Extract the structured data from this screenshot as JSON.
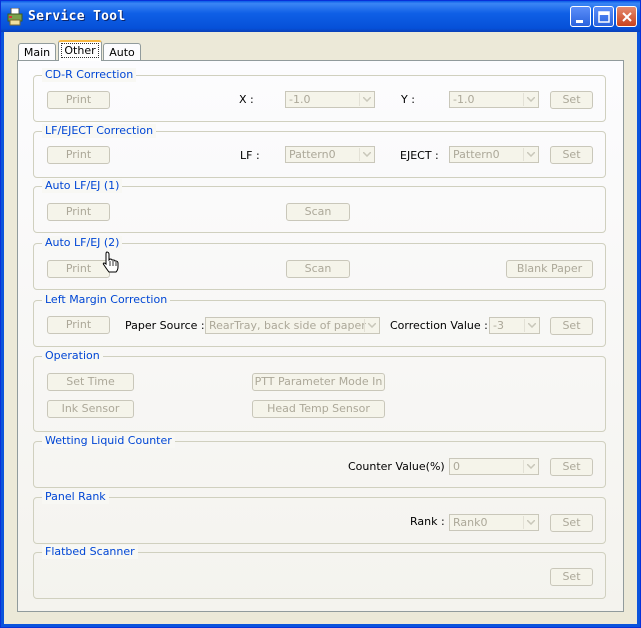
{
  "window": {
    "title": "Service Tool"
  },
  "tabs": [
    "Main",
    "Other",
    "Auto"
  ],
  "groups": {
    "cdr": {
      "title": "CD-R Correction",
      "print": "Print",
      "x_label": "X :",
      "x_value": "-1.0",
      "y_label": "Y :",
      "y_value": "-1.0",
      "set": "Set"
    },
    "lf_eject": {
      "title": "LF/EJECT Correction",
      "print": "Print",
      "lf_label": "LF :",
      "lf_value": "Pattern0",
      "eject_label": "EJECT :",
      "eject_value": "Pattern0",
      "set": "Set"
    },
    "auto1": {
      "title": "Auto LF/EJ (1)",
      "print": "Print",
      "scan": "Scan"
    },
    "auto2": {
      "title": "Auto LF/EJ (2)",
      "print": "Print",
      "scan": "Scan",
      "blank": "Blank Paper"
    },
    "left_margin": {
      "title": "Left Margin Correction",
      "print": "Print",
      "source_label": "Paper Source :",
      "source_value": "RearTray, back side of paper",
      "value_label": "Correction Value :",
      "value_value": "-3",
      "set": "Set"
    },
    "operation": {
      "title": "Operation",
      "set_time": "Set Time",
      "ptt": "PTT Parameter Mode In",
      "ink_sensor": "Ink Sensor",
      "head_temp": "Head Temp Sensor"
    },
    "wetting": {
      "title": "Wetting Liquid Counter",
      "label": "Counter Value(%) :",
      "value": "0",
      "set": "Set"
    },
    "panel_rank": {
      "title": "Panel Rank",
      "label": "Rank :",
      "value": "Rank0",
      "set": "Set"
    },
    "flatbed": {
      "title": "Flatbed Scanner",
      "set": "Set"
    }
  },
  "colors": {
    "title_bar": "#0a5ce7",
    "group_title": "#0046d5",
    "disabled_text": "#aca899",
    "active_tab_accent": "#f9b840"
  }
}
